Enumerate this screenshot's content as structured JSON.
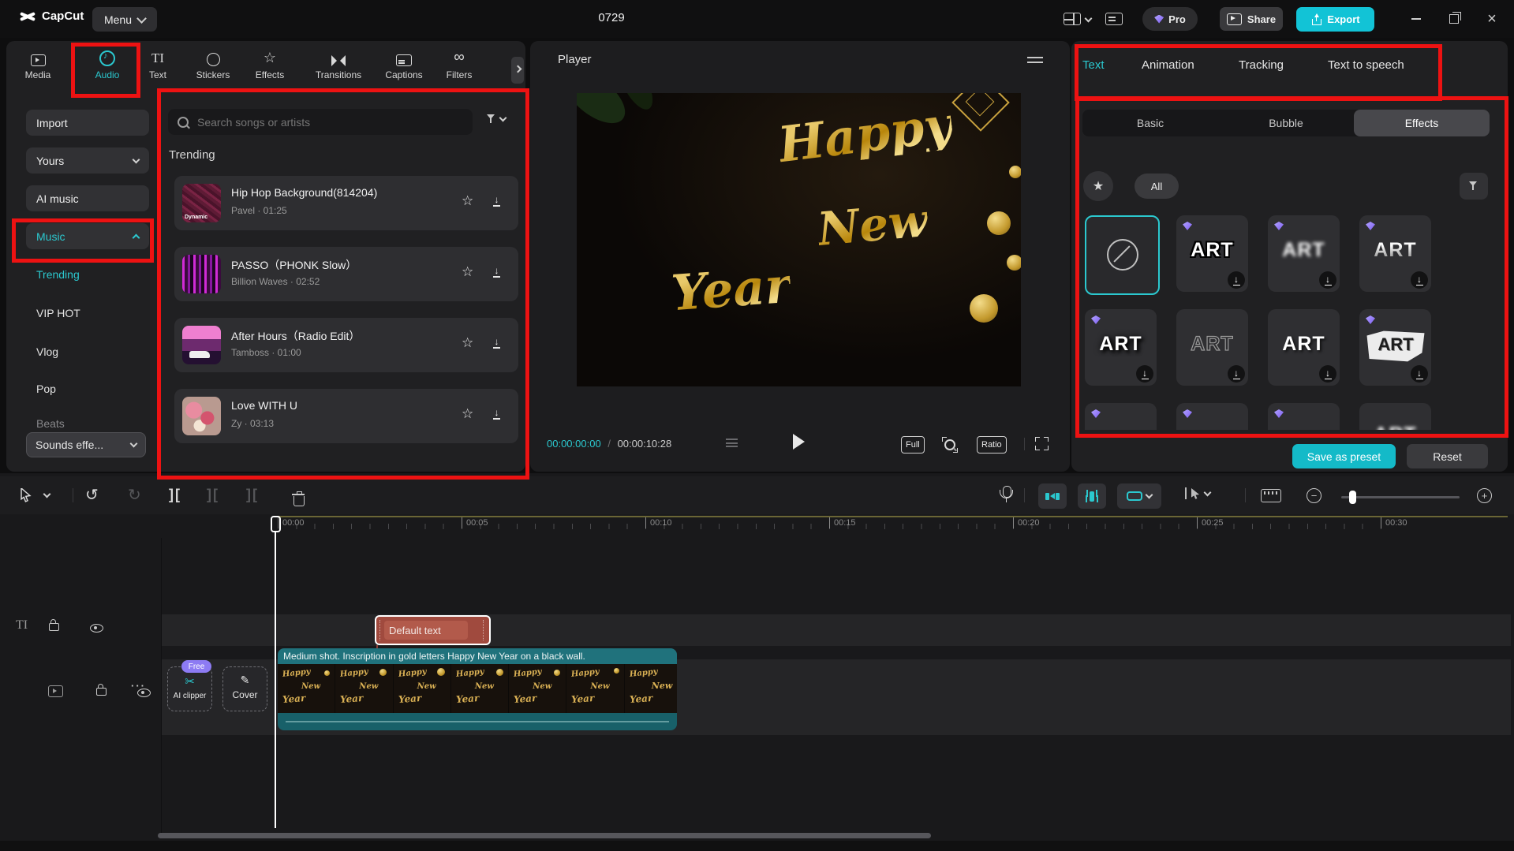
{
  "topbar": {
    "app_name": "CapCut",
    "menu_label": "Menu",
    "project_title": "0729",
    "pro_label": "Pro",
    "share_label": "Share",
    "export_label": "Export"
  },
  "media_tabs": [
    {
      "label": "Media",
      "active": false
    },
    {
      "label": "Audio",
      "active": true
    },
    {
      "label": "Text",
      "active": false
    },
    {
      "label": "Stickers",
      "active": false
    },
    {
      "label": "Effects",
      "active": false
    },
    {
      "label": "Transitions",
      "active": false
    },
    {
      "label": "Captions",
      "active": false
    },
    {
      "label": "Filters",
      "active": false
    }
  ],
  "audio_nav": {
    "import_label": "Import",
    "yours_label": "Yours",
    "ai_music_label": "AI music",
    "music_label": "Music",
    "sub_items": [
      "Trending",
      "VIP HOT",
      "Vlog",
      "Pop",
      "Beats"
    ],
    "sounds_label": "Sounds effe..."
  },
  "music_panel": {
    "search_placeholder": "Search songs or artists",
    "section_title": "Trending",
    "songs": [
      {
        "title": "Hip Hop Background(814204)",
        "artist": "Pavel",
        "duration": "01:25",
        "subtitle": "Pavel · 01:25",
        "thumb_label": "Dynamic"
      },
      {
        "title": "PASSO（PHONK Slow）",
        "artist": "Billion Waves",
        "duration": "02:52",
        "subtitle": "Billion Waves · 02:52"
      },
      {
        "title": "After Hours（Radio Edit）",
        "artist": "Tamboss",
        "duration": "01:00",
        "subtitle": "Tamboss · 01:00"
      },
      {
        "title": "Love WITH U",
        "artist": "Zy",
        "duration": "03:13",
        "subtitle": "Zy · 03:13"
      }
    ]
  },
  "player": {
    "header": "Player",
    "current_time": "00:00:00:00",
    "time_separator": "/",
    "duration": "00:00:10:28",
    "full_label": "Full",
    "ratio_label": "Ratio",
    "video_text": {
      "line1": "Happy",
      "line2": "New",
      "line3": "Year"
    }
  },
  "text_panel": {
    "tabs": [
      "Text",
      "Animation",
      "Tracking",
      "Text to speech"
    ],
    "active_tab": "Text",
    "subtabs": [
      "Basic",
      "Bubble",
      "Effects"
    ],
    "active_subtab": "Effects",
    "all_label": "All",
    "art_label": "ART",
    "save_preset_label": "Save as preset",
    "reset_label": "Reset"
  },
  "timeline": {
    "ruler_labels": [
      "00:00",
      "00:05",
      "00:10",
      "00:15",
      "00:20",
      "00:25",
      "00:30"
    ],
    "text_clip_label": "Default text",
    "video_caption": "Medium shot. Inscription in gold letters Happy New Year on a black wall.",
    "ai_clipper": {
      "badge": "Free",
      "label": "AI clipper"
    },
    "cover_label": "Cover"
  },
  "annotations": {
    "color": "#ed1212",
    "highlighted_regions": [
      "audio-tab",
      "music-nav-item",
      "music-list-panel",
      "text-panel-tabs",
      "text-effects-grid"
    ]
  },
  "colors": {
    "accent_teal": "#2bc8cf",
    "export_teal": "#12c3d6",
    "pro_purple": "#8d7bf3",
    "annotation_red": "#ed1212",
    "text_clip_brown": "#a04a3e",
    "video_clip_teal": "#20727c"
  }
}
